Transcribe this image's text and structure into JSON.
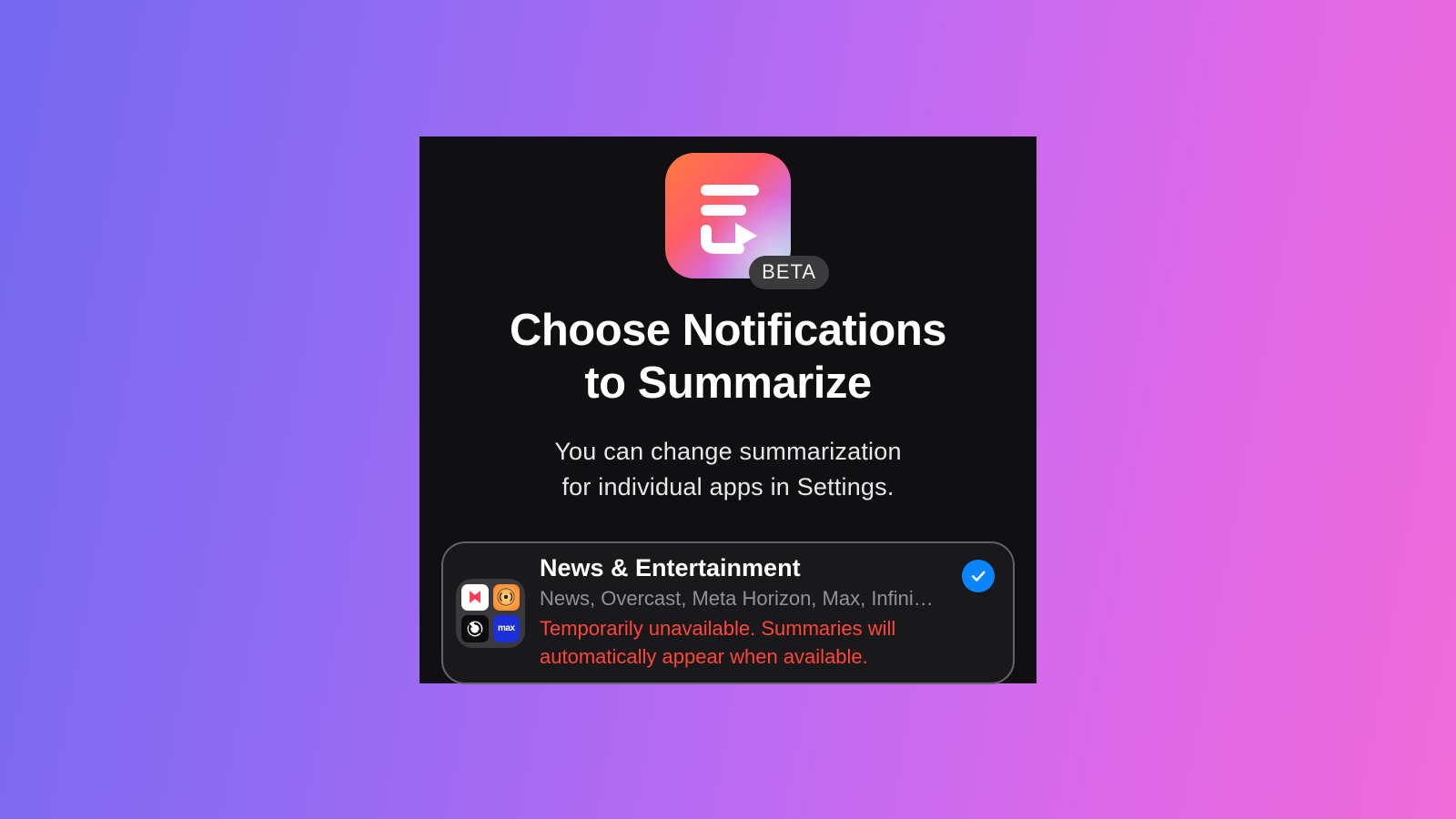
{
  "badge": {
    "label": "BETA"
  },
  "heading": {
    "line1": "Choose Notifications",
    "line2": "to Summarize"
  },
  "subheading": {
    "line1": "You can change summarization",
    "line2": "for individual apps in Settings."
  },
  "category": {
    "title": "News & Entertainment",
    "apps_line": "News, Overcast, Meta Horizon, Max, Infini…",
    "warning_line1": "Temporarily unavailable. Summaries will",
    "warning_line2": "automatically appear when available.",
    "selected": true,
    "mini_icons": [
      "news-icon",
      "overcast-icon",
      "sync-icon",
      "max-icon"
    ],
    "max_label": "max"
  },
  "icons": {
    "hero": "summarize-glyph-icon"
  },
  "colors": {
    "panel_bg": "#101012",
    "warning": "#ff453a",
    "accent_blue": "#0a84ff"
  }
}
